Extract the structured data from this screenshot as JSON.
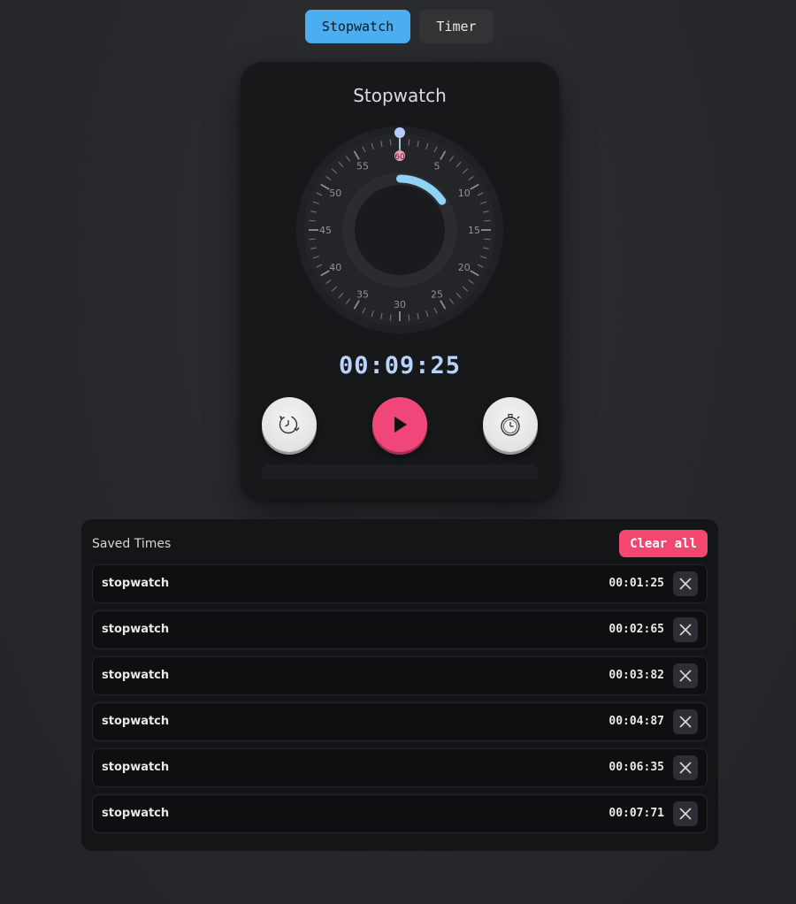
{
  "tabs": [
    {
      "label": "Stopwatch",
      "active": true
    },
    {
      "label": "Timer",
      "active": false
    }
  ],
  "stopwatch": {
    "title": "Stopwatch",
    "time": "00:09:25",
    "progress_seconds": 9.25,
    "dial_labels": [
      "60",
      "5",
      "10",
      "15",
      "20",
      "25",
      "30",
      "35",
      "40",
      "45",
      "50",
      "55"
    ],
    "buttons": {
      "reset_icon": "reset-clock-icon",
      "play_icon": "play-icon",
      "lap_icon": "stopwatch-icon"
    },
    "colors": {
      "accent": "#4aaef0",
      "progress_arc": "#8fd3f4",
      "time_text": "#b9d3ff",
      "play_button": "#f0467a"
    }
  },
  "saved": {
    "title": "Saved Times",
    "clear_label": "Clear all",
    "items": [
      {
        "label": "stopwatch",
        "time": "00:01:25"
      },
      {
        "label": "stopwatch",
        "time": "00:02:65"
      },
      {
        "label": "stopwatch",
        "time": "00:03:82"
      },
      {
        "label": "stopwatch",
        "time": "00:04:87"
      },
      {
        "label": "stopwatch",
        "time": "00:06:35"
      },
      {
        "label": "stopwatch",
        "time": "00:07:71"
      }
    ]
  }
}
